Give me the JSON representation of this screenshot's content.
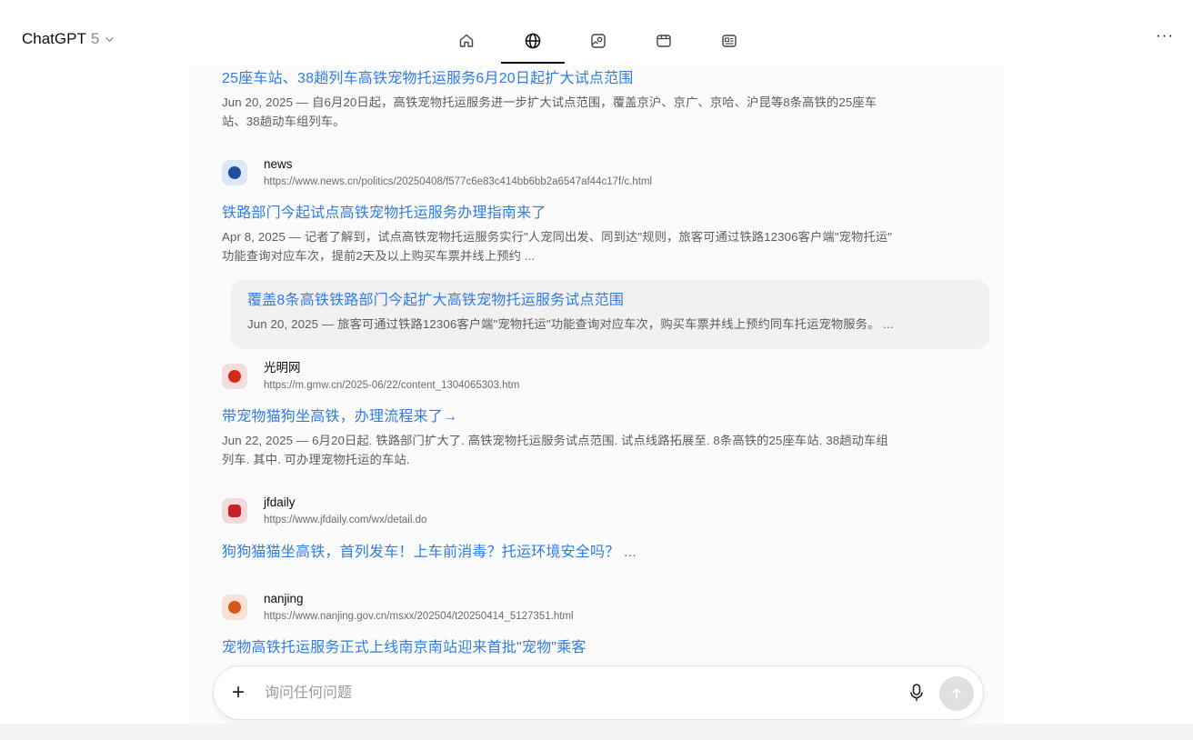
{
  "header": {
    "model_name": "ChatGPT",
    "model_version": "5",
    "more_label": "···"
  },
  "tabs": [
    {
      "icon": "home-icon"
    },
    {
      "icon": "globe-icon",
      "active": true
    },
    {
      "icon": "image-search-icon"
    },
    {
      "icon": "video-icon"
    },
    {
      "icon": "news-icon"
    }
  ],
  "results": {
    "r0": {
      "title": "25座车站、38趟列车高铁宠物托运服务6月20日起扩大试点范围",
      "snippet_l1": "Jun 20, 2025 — 自6月20日起，高铁宠物托运服务进一步扩大试点范围，覆盖京沪、京广、京哈、沪昆等8条高铁的25座车",
      "snippet_l2": "站、38趟动车组列车。"
    },
    "r1": {
      "source_name": "news",
      "source_url": "https://www.news.cn/politics/20250408/f577c6e83c414bb6bb2a6547af44c17f/c.html",
      "title": "铁路部门今起试点高铁宠物托运服务办理指南来了",
      "snippet_l1": "Apr 8, 2025 — 记者了解到，试点高铁宠物托运服务实行\"人宠同出发、同到达\"规则，旅客可通过铁路12306客户端\"宠物托运\"",
      "snippet_l2": "功能查询对应车次，提前2天及以上购买车票并线上预约 ..."
    },
    "r1_sub": {
      "title": "覆盖8条高铁铁路部门今起扩大高铁宠物托运服务试点范围",
      "snippet": "Jun 20, 2025 — 旅客可通过铁路12306客户端\"宠物托运\"功能查询对应车次，购买车票并线上预约同车托运宠物服务。 ..."
    },
    "r2": {
      "source_name": "光明网",
      "source_url": "https://m.gmw.cn/2025-06/22/content_1304065303.htm",
      "title": "带宠物猫狗坐高铁，办理流程来了→",
      "snippet_l1": "Jun 22, 2025 — 6月20日起. 铁路部门扩大了. 高铁宠物托运服务试点范围. 试点线路拓展至. 8条高铁的25座车站. 38趟动车组",
      "snippet_l2": "列车. 其中. 可办理宠物托运的车站."
    },
    "r3": {
      "source_name": "jfdaily",
      "source_url": "https://www.jfdaily.com/wx/detail.do",
      "title": "狗狗猫猫坐高铁，首列发车！上车前消毒？托运环境安全吗？ ..."
    },
    "r4": {
      "source_name": "nanjing",
      "source_url": "https://www.nanjing.gov.cn/msxx/202504/t20250414_5127351.html",
      "title": "宠物高铁托运服务正式上线南京南站迎来首批\"宠物\"乘客"
    }
  },
  "composer": {
    "placeholder": "询问任何问题"
  },
  "colors": {
    "link": "#2f7de1",
    "news_icon_bg": "#dde7f7",
    "gmw_icon_bg": "#f6dcdc",
    "jfdaily_icon_bg": "#f4dadb",
    "nanjing_icon_bg": "#f7e3d6"
  }
}
